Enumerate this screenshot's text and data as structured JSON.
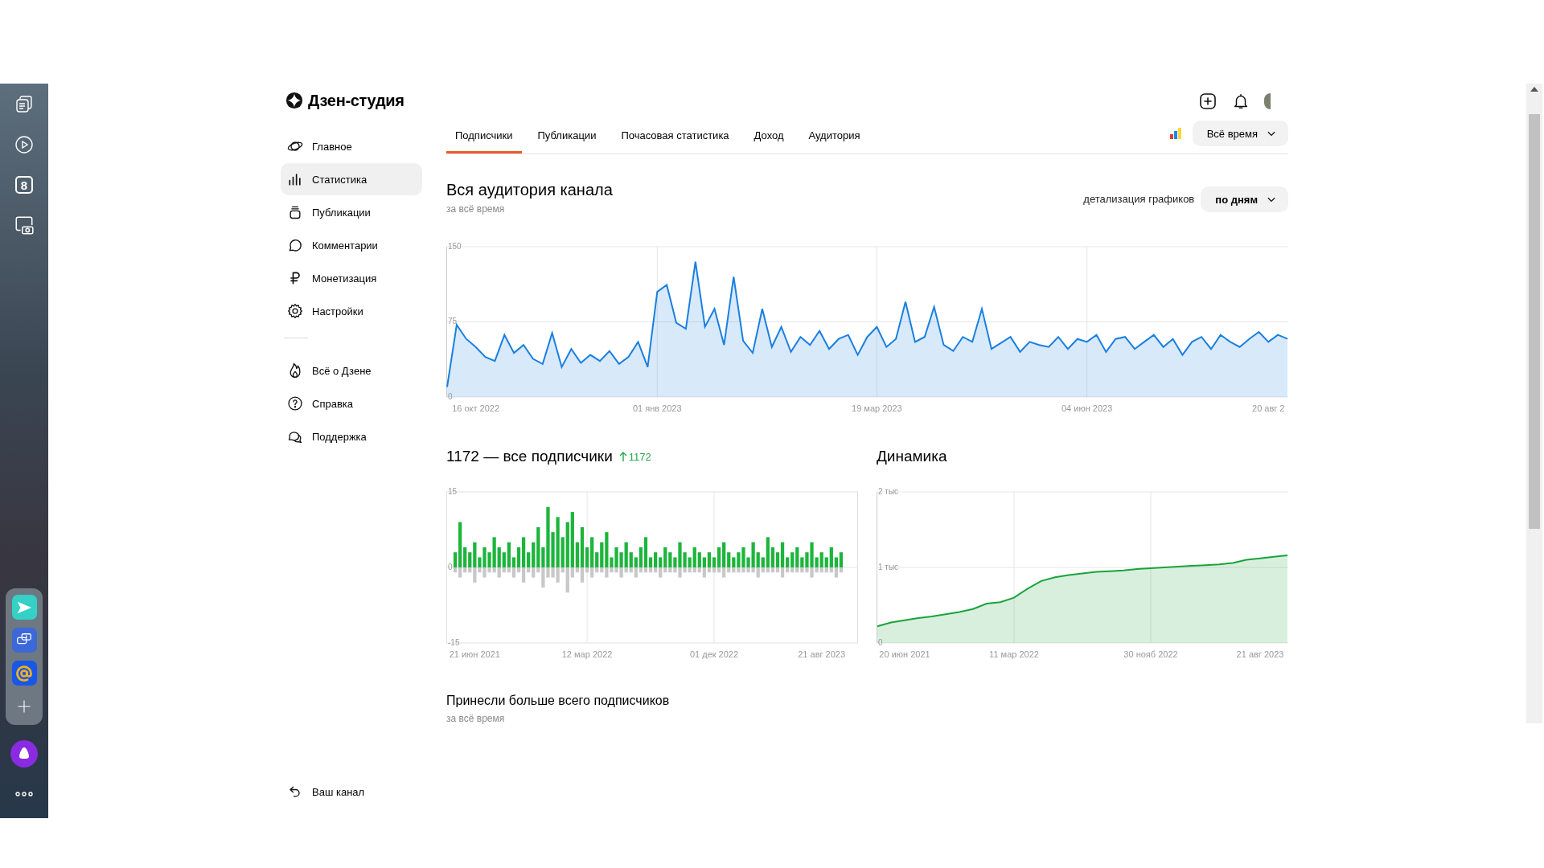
{
  "browser_sidebar": {
    "badge": "8"
  },
  "logo": {
    "text": "Дзен-студия"
  },
  "nav": {
    "main": [
      {
        "label": "Главное",
        "selected": false
      },
      {
        "label": "Статистика",
        "selected": true
      },
      {
        "label": "Публикации",
        "selected": false
      },
      {
        "label": "Комментарии",
        "selected": false
      },
      {
        "label": "Монетизация",
        "selected": false
      },
      {
        "label": "Настройки",
        "selected": false
      }
    ],
    "secondary": [
      {
        "label": "Всё о Дзене",
        "selected": false
      },
      {
        "label": "Справка",
        "selected": false
      },
      {
        "label": "Поддержка",
        "selected": false
      }
    ],
    "footer": {
      "label": "Ваш канал"
    }
  },
  "tabs": [
    {
      "label": "Подписчики",
      "selected": true
    },
    {
      "label": "Публикации",
      "selected": false
    },
    {
      "label": "Почасовая статистика",
      "selected": false
    },
    {
      "label": "Доход",
      "selected": false
    },
    {
      "label": "Аудитория",
      "selected": false
    }
  ],
  "period_select": {
    "value": "Всё время"
  },
  "audience": {
    "title": "Вся аудитория канала",
    "subtitle": "за всё время",
    "detail_label": "детализация графиков",
    "detail_select": {
      "value": "по дням"
    },
    "chart_data": {
      "type": "area",
      "grid": true,
      "ylim": [
        0,
        150
      ],
      "yticks": [
        0,
        75,
        150
      ],
      "categories": [
        null,
        null,
        null,
        "16 окт 2022",
        null,
        null,
        null,
        null,
        null,
        null,
        null,
        null,
        null,
        null,
        null,
        null,
        null,
        null,
        null,
        null,
        null,
        null,
        "01 янв 2023",
        null,
        null,
        null,
        null,
        null,
        null,
        null,
        null,
        null,
        null,
        null,
        null,
        null,
        null,
        null,
        null,
        null,
        null,
        null,
        null,
        null,
        null,
        "19 мар 2023",
        null,
        null,
        null,
        null,
        null,
        null,
        null,
        null,
        null,
        null,
        null,
        null,
        null,
        null,
        null,
        null,
        null,
        null,
        null,
        null,
        null,
        "04 июн 2023",
        null,
        null,
        null,
        null,
        null,
        null,
        null,
        null,
        null,
        null,
        null,
        null,
        null,
        null,
        null,
        null,
        null,
        null,
        "20 авг 2",
        null,
        null
      ],
      "series": [
        {
          "color": "#1a7fe0",
          "values": [
            10,
            72,
            58,
            50,
            40,
            36,
            62,
            44,
            52,
            38,
            33,
            64,
            30,
            48,
            34,
            42,
            36,
            46,
            33,
            40,
            55,
            30,
            105,
            112,
            74,
            68,
            135,
            70,
            88,
            52,
            120,
            56,
            44,
            88,
            50,
            70,
            45,
            60,
            52,
            66,
            48,
            58,
            62,
            42,
            60,
            70,
            50,
            58,
            95,
            55,
            60,
            90,
            52,
            46,
            60,
            55,
            88,
            48,
            54,
            60,
            45,
            55,
            52,
            50,
            60,
            48,
            58,
            55,
            62,
            45,
            58,
            60,
            48,
            55,
            62,
            50,
            58,
            42,
            55,
            60,
            48,
            62,
            55,
            50,
            58,
            65,
            55,
            62,
            58
          ]
        }
      ]
    }
  },
  "subscribers": {
    "title": "1172 — все подписчики",
    "delta": "1172",
    "chart_data": {
      "type": "bar",
      "stacked": true,
      "grid": true,
      "ylim": [
        -15,
        15
      ],
      "yticks": [
        -15,
        0,
        15
      ],
      "categories": [
        null,
        null,
        null,
        null,
        "21 июн 2021",
        null,
        null,
        null,
        null,
        null,
        null,
        null,
        null,
        null,
        null,
        null,
        null,
        null,
        null,
        null,
        null,
        null,
        null,
        null,
        null,
        null,
        null,
        "12 мар 2022",
        null,
        null,
        null,
        null,
        null,
        null,
        null,
        null,
        null,
        null,
        null,
        null,
        null,
        null,
        null,
        null,
        null,
        null,
        null,
        null,
        null,
        null,
        null,
        null,
        null,
        "01 дек 2022",
        null,
        null,
        null,
        null,
        null,
        null,
        null,
        null,
        null,
        null,
        null,
        null,
        null,
        null,
        null,
        null,
        null,
        null,
        null,
        null,
        null,
        "21 авг 2023",
        null,
        null,
        null,
        null
      ],
      "series": [
        {
          "color": "#1db53c",
          "values": [
            3,
            9,
            4,
            3,
            5,
            2,
            4,
            3,
            6,
            4,
            3,
            5,
            2,
            4,
            6,
            3,
            5,
            8,
            4,
            12,
            7,
            10,
            6,
            9,
            11,
            5,
            8,
            4,
            6,
            3,
            5,
            7,
            2,
            4,
            3,
            5,
            3,
            2,
            4,
            6,
            2,
            3,
            2,
            4,
            3,
            2,
            5,
            3,
            2,
            4,
            3,
            2,
            3,
            2,
            4,
            5,
            3,
            2,
            3,
            4,
            2,
            5,
            3,
            2,
            6,
            4,
            3,
            5,
            2,
            3,
            4,
            2,
            3,
            5,
            2,
            3,
            2,
            4,
            2,
            3
          ]
        },
        {
          "color": "#c8c8c8",
          "values": [
            -1,
            -2,
            -1,
            -1,
            -3,
            -1,
            -2,
            -1,
            -1,
            -2,
            -1,
            -1,
            -2,
            -1,
            -3,
            -1,
            -2,
            -1,
            -4,
            -2,
            -2,
            -3,
            -1,
            -5,
            -2,
            -1,
            -3,
            -1,
            -2,
            -1,
            -1,
            -2,
            -1,
            -1,
            -2,
            -1,
            -1,
            -2,
            -1,
            -1,
            -1,
            -1,
            -2,
            -1,
            -1,
            -1,
            -2,
            -1,
            -1,
            -1,
            -1,
            -2,
            -1,
            -1,
            -1,
            -2,
            -1,
            -1,
            -1,
            -1,
            -1,
            -1,
            -2,
            -1,
            -1,
            -1,
            -1,
            -2,
            -1,
            -1,
            -1,
            -1,
            -1,
            -2,
            -1,
            -1,
            -1,
            -1,
            -2,
            -1
          ]
        }
      ]
    }
  },
  "dynamics": {
    "title": "Динамика",
    "chart_data": {
      "type": "area",
      "grid": true,
      "ylim": [
        0,
        2
      ],
      "yticks": [
        {
          "value": 0,
          "label": "0"
        },
        {
          "value": 1,
          "label": "1 тыс"
        },
        {
          "value": 2,
          "label": "2 тыс"
        }
      ],
      "categories": [
        null,
        null,
        "20 июн 2021",
        null,
        null,
        null,
        null,
        null,
        null,
        null,
        "11 мар 2022",
        null,
        null,
        null,
        null,
        null,
        null,
        null,
        null,
        null,
        "30 нояб 2022",
        null,
        null,
        null,
        null,
        null,
        null,
        null,
        "21 авг 2023",
        null,
        null
      ],
      "series": [
        {
          "color": "#1aa33a",
          "values": [
            0.22,
            0.27,
            0.3,
            0.33,
            0.35,
            0.38,
            0.41,
            0.45,
            0.52,
            0.54,
            0.6,
            0.72,
            0.82,
            0.87,
            0.9,
            0.92,
            0.94,
            0.95,
            0.96,
            0.98,
            0.99,
            1,
            1.01,
            1.02,
            1.03,
            1.04,
            1.06,
            1.1,
            1.12,
            1.14,
            1.16
          ]
        }
      ]
    }
  },
  "top_sources": {
    "title": "Принесли больше всего подписчиков",
    "subtitle": "за всё время"
  }
}
